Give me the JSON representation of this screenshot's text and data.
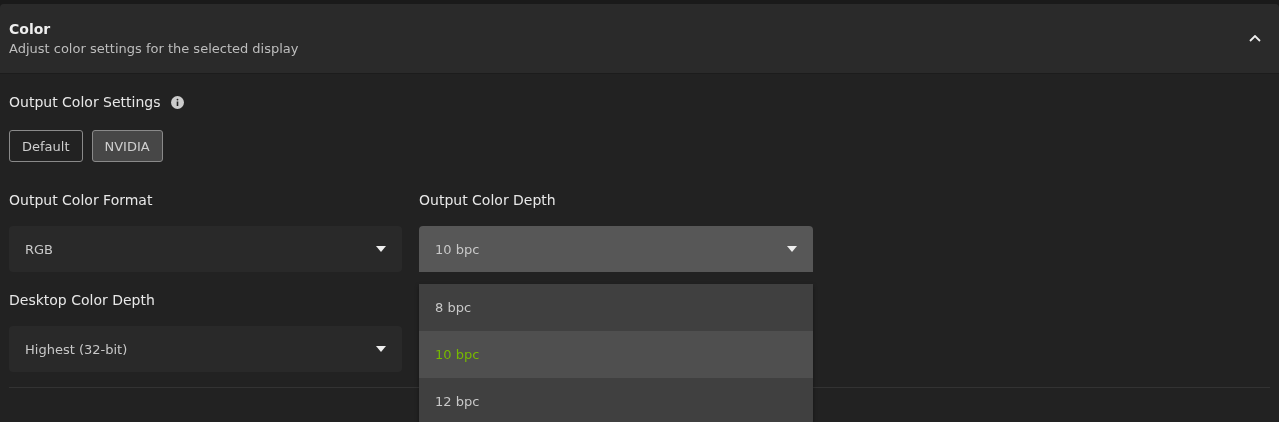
{
  "section": {
    "title": "Color",
    "subtitle": "Adjust color settings for the selected display",
    "expanded": true
  },
  "output_color_settings": {
    "label": "Output Color Settings",
    "options": [
      {
        "label": "Default",
        "selected": false
      },
      {
        "label": "NVIDIA",
        "selected": true
      }
    ]
  },
  "selects": [
    {
      "label": "Output Color Format",
      "value": "RGB",
      "open": false
    },
    {
      "label": "Output Color Depth",
      "value": "10 bpc",
      "open": true,
      "options": [
        {
          "label": "8 bpc",
          "selected": false
        },
        {
          "label": "10 bpc",
          "selected": true
        },
        {
          "label": "12 bpc",
          "selected": false
        }
      ]
    },
    {
      "label": "Desktop Color Depth",
      "value": "Highest (32-bit)",
      "open": false
    }
  ]
}
